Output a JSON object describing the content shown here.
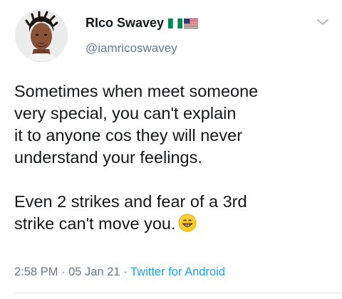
{
  "user": {
    "display_name": "RIco Swavey",
    "handle": "@iamricoswavey",
    "flags": [
      "nigeria-flag",
      "usa-flag"
    ]
  },
  "tweet": {
    "lines_paragraph_1": [
      "Sometimes when meet someone",
      "very special,  you can't explain",
      "it to anyone cos they will never",
      "understand your feelings."
    ],
    "lines_paragraph_2": [
      "Even 2 strikes and fear of a 3rd",
      "strike can't move you."
    ],
    "emoji": "grinning-face-icon"
  },
  "meta": {
    "time": "2:58 PM",
    "separator_1": " · ",
    "date": "05 Jan 21",
    "separator_2": " · ",
    "source": "Twitter for Android"
  },
  "colors": {
    "text": "#14171a",
    "secondary": "#657786",
    "link": "#1da1f2",
    "divider": "#e1e8ed"
  }
}
